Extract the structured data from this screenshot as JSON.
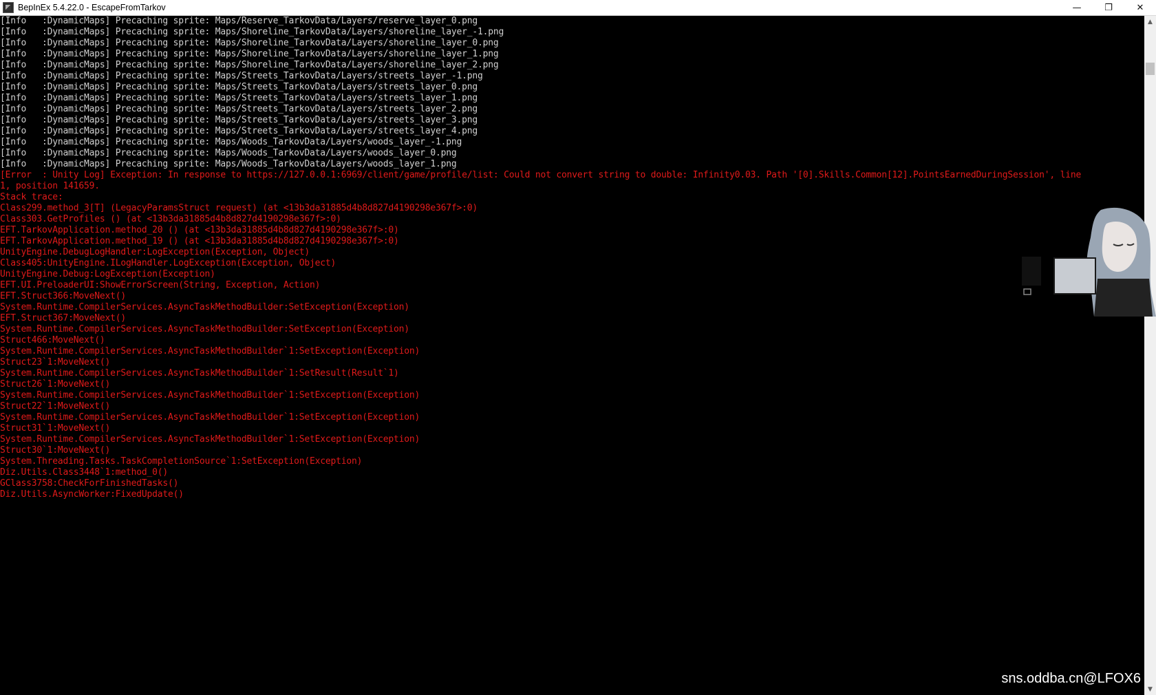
{
  "window": {
    "title": "BepInEx 5.4.22.0 - EscapeFromTarkov",
    "minimize_glyph": "—",
    "restore_glyph": "❐",
    "close_glyph": "✕"
  },
  "console": {
    "info_lines": [
      "[Info   :DynamicMaps] Precaching sprite: Maps/Reserve_TarkovData/Layers/reserve_layer_0.png",
      "[Info   :DynamicMaps] Precaching sprite: Maps/Shoreline_TarkovData/Layers/shoreline_layer_-1.png",
      "[Info   :DynamicMaps] Precaching sprite: Maps/Shoreline_TarkovData/Layers/shoreline_layer_0.png",
      "[Info   :DynamicMaps] Precaching sprite: Maps/Shoreline_TarkovData/Layers/shoreline_layer_1.png",
      "[Info   :DynamicMaps] Precaching sprite: Maps/Shoreline_TarkovData/Layers/shoreline_layer_2.png",
      "[Info   :DynamicMaps] Precaching sprite: Maps/Streets_TarkovData/Layers/streets_layer_-1.png",
      "[Info   :DynamicMaps] Precaching sprite: Maps/Streets_TarkovData/Layers/streets_layer_0.png",
      "[Info   :DynamicMaps] Precaching sprite: Maps/Streets_TarkovData/Layers/streets_layer_1.png",
      "[Info   :DynamicMaps] Precaching sprite: Maps/Streets_TarkovData/Layers/streets_layer_2.png",
      "[Info   :DynamicMaps] Precaching sprite: Maps/Streets_TarkovData/Layers/streets_layer_3.png",
      "[Info   :DynamicMaps] Precaching sprite: Maps/Streets_TarkovData/Layers/streets_layer_4.png",
      "[Info   :DynamicMaps] Precaching sprite: Maps/Woods_TarkovData/Layers/woods_layer_-1.png",
      "[Info   :DynamicMaps] Precaching sprite: Maps/Woods_TarkovData/Layers/woods_layer_0.png",
      "[Info   :DynamicMaps] Precaching sprite: Maps/Woods_TarkovData/Layers/woods_layer_1.png"
    ],
    "error_lines": [
      "[Error  : Unity Log] Exception: In response to https://127.0.0.1:6969/client/game/profile/list: Could not convert string to double: Infinity0.03. Path '[0].Skills.Common[12].PointsEarnedDuringSession', line",
      "1, position 141659.",
      "Stack trace:",
      "Class299.method_3[T] (LegacyParamsStruct request) (at <13b3da31885d4b8d827d4190298e367f>:0)",
      "Class303.GetProfiles () (at <13b3da31885d4b8d827d4190298e367f>:0)",
      "EFT.TarkovApplication.method_20 () (at <13b3da31885d4b8d827d4190298e367f>:0)",
      "EFT.TarkovApplication.method_19 () (at <13b3da31885d4b8d827d4190298e367f>:0)",
      "UnityEngine.DebugLogHandler:LogException(Exception, Object)",
      "Class405:UnityEngine.ILogHandler.LogException(Exception, Object)",
      "UnityEngine.Debug:LogException(Exception)",
      "EFT.UI.PreloaderUI:ShowErrorScreen(String, Exception, Action)",
      "EFT.Struct366:MoveNext()",
      "System.Runtime.CompilerServices.AsyncTaskMethodBuilder:SetException(Exception)",
      "EFT.Struct367:MoveNext()",
      "System.Runtime.CompilerServices.AsyncTaskMethodBuilder:SetException(Exception)",
      "Struct466:MoveNext()",
      "System.Runtime.CompilerServices.AsyncTaskMethodBuilder`1:SetException(Exception)",
      "Struct23`1:MoveNext()",
      "System.Runtime.CompilerServices.AsyncTaskMethodBuilder`1:SetResult(Result`1)",
      "Struct26`1:MoveNext()",
      "System.Runtime.CompilerServices.AsyncTaskMethodBuilder`1:SetException(Exception)",
      "Struct22`1:MoveNext()",
      "System.Runtime.CompilerServices.AsyncTaskMethodBuilder`1:SetException(Exception)",
      "Struct31`1:MoveNext()",
      "System.Runtime.CompilerServices.AsyncTaskMethodBuilder`1:SetException(Exception)",
      "Struct30`1:MoveNext()",
      "System.Threading.Tasks.TaskCompletionSource`1:SetException(Exception)",
      "Diz.Utils.Class3448`1:method_0()",
      "GClass3758:CheckForFinishedTasks()",
      "Diz.Utils.AsyncWorker:FixedUpdate()"
    ]
  },
  "scrollbar": {
    "up_arrow": "▲",
    "down_arrow": "▼"
  },
  "overlay": {
    "watermark": "sns.oddba.cn@LFOX6"
  },
  "colors": {
    "info_text": "#cfcfcf",
    "error_text": "#e01a1a",
    "background": "#000000"
  }
}
